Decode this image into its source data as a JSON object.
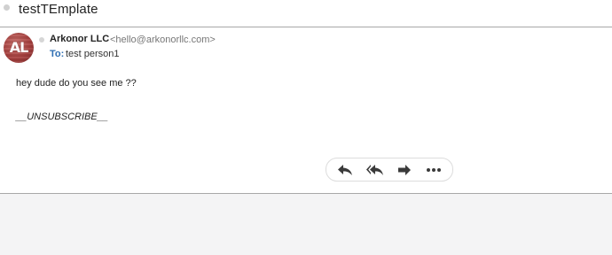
{
  "subject": "testTEmplate",
  "sender": {
    "avatar_initials": "AL",
    "name": "Arkonor LLC",
    "email": "<hello@arkonorllc.com>"
  },
  "recipients": {
    "to_label": "To:",
    "to_value": "test person1"
  },
  "body": {
    "line1": "hey dude do you see me ??",
    "line2": "__UNSUBSCRIBE__"
  },
  "actions": [
    {
      "icon": "reply-icon"
    },
    {
      "icon": "reply-all-icon"
    },
    {
      "icon": "forward-icon"
    },
    {
      "icon": "more-icon"
    }
  ],
  "colors": {
    "to_label": "#2f6fb3",
    "avatar": "#a7403e",
    "lower_background": "#f4f4f5"
  }
}
